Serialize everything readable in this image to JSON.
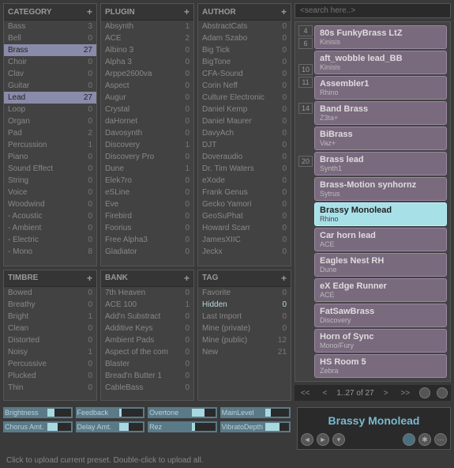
{
  "search_placeholder": "<search here..>",
  "panels": {
    "category": {
      "title": "CATEGORY",
      "items": [
        {
          "n": "Bass",
          "c": 3
        },
        {
          "n": "Bell",
          "c": 0
        },
        {
          "n": "Brass",
          "c": 27,
          "sel": true
        },
        {
          "n": "Choir",
          "c": 0
        },
        {
          "n": "Clav",
          "c": 0
        },
        {
          "n": "Guitar",
          "c": 0
        },
        {
          "n": "Lead",
          "c": 27,
          "sel": true
        },
        {
          "n": "Loop",
          "c": 0
        },
        {
          "n": "Organ",
          "c": 0
        },
        {
          "n": "Pad",
          "c": 2
        },
        {
          "n": "Percussion",
          "c": 1
        },
        {
          "n": "Piano",
          "c": 0
        },
        {
          "n": "Sound Effect",
          "c": 0
        },
        {
          "n": "String",
          "c": 0
        },
        {
          "n": "Voice",
          "c": 0
        },
        {
          "n": "Woodwind",
          "c": 0
        },
        {
          "n": "  - Acoustic",
          "c": 0
        },
        {
          "n": "  - Ambient",
          "c": 0
        },
        {
          "n": "  - Electric",
          "c": 0
        },
        {
          "n": "  - Mono",
          "c": 8
        }
      ]
    },
    "plugin": {
      "title": "PLUGIN",
      "items": [
        {
          "n": "Absynth",
          "c": 1
        },
        {
          "n": "ACE",
          "c": 2
        },
        {
          "n": "Albino 3",
          "c": 0
        },
        {
          "n": "Alpha 3",
          "c": 0
        },
        {
          "n": "Arppe2600va",
          "c": 0
        },
        {
          "n": "Aspect",
          "c": 0
        },
        {
          "n": "Augur",
          "c": 0
        },
        {
          "n": "Crystal",
          "c": 0
        },
        {
          "n": "daHornet",
          "c": 0
        },
        {
          "n": "Davosynth",
          "c": 0
        },
        {
          "n": "Discovery",
          "c": 1
        },
        {
          "n": "Discovery Pro",
          "c": 0
        },
        {
          "n": "Dune",
          "c": 1
        },
        {
          "n": "Elek7ro",
          "c": 0
        },
        {
          "n": "eSLine",
          "c": 0
        },
        {
          "n": "Eve",
          "c": 0
        },
        {
          "n": "Firebird",
          "c": 0
        },
        {
          "n": "Foorius",
          "c": 0
        },
        {
          "n": "Free Alpha3",
          "c": 0
        },
        {
          "n": "Gladiator",
          "c": 0
        }
      ]
    },
    "author": {
      "title": "AUTHOR",
      "items": [
        {
          "n": "AbstractCats",
          "c": 0
        },
        {
          "n": "Adam Szabo",
          "c": 0
        },
        {
          "n": "Big Tick",
          "c": 0
        },
        {
          "n": "BigTone",
          "c": 0
        },
        {
          "n": "CFA-Sound",
          "c": 0
        },
        {
          "n": "Corin Neff",
          "c": 0
        },
        {
          "n": "Culture Electronic",
          "c": 0
        },
        {
          "n": "Daniel Kemp",
          "c": 0
        },
        {
          "n": "Daniel Maurer",
          "c": 0
        },
        {
          "n": "DavyAch",
          "c": 0
        },
        {
          "n": "DJT",
          "c": 0
        },
        {
          "n": "Doveraudio",
          "c": 0
        },
        {
          "n": "Dr. Tim Waters",
          "c": 0
        },
        {
          "n": "eXode",
          "c": 0
        },
        {
          "n": "Frank Genus",
          "c": 0
        },
        {
          "n": "Gecko Yamori",
          "c": 0
        },
        {
          "n": "GeoSuPhat",
          "c": 0
        },
        {
          "n": "Howard Scarr",
          "c": 0
        },
        {
          "n": "JamesXIIC",
          "c": 0
        },
        {
          "n": "Jeckx",
          "c": 0
        }
      ]
    },
    "timbre": {
      "title": "TIMBRE",
      "items": [
        {
          "n": "Bowed",
          "c": 0
        },
        {
          "n": "Breathy",
          "c": 0
        },
        {
          "n": "Bright",
          "c": 1
        },
        {
          "n": "Clean",
          "c": 0
        },
        {
          "n": "Distorted",
          "c": 0
        },
        {
          "n": "Noisy",
          "c": 1
        },
        {
          "n": "Percussive",
          "c": 0
        },
        {
          "n": "Plucked",
          "c": 0
        },
        {
          "n": "Thin",
          "c": 0
        }
      ]
    },
    "bank": {
      "title": "BANK",
      "items": [
        {
          "n": "7th Heaven",
          "c": 0
        },
        {
          "n": "ACE 100",
          "c": 1
        },
        {
          "n": "Add'n Substract",
          "c": 0
        },
        {
          "n": "Additive Keys",
          "c": 0
        },
        {
          "n": "Ambient Pads",
          "c": 0
        },
        {
          "n": "Aspect of the com",
          "c": 0
        },
        {
          "n": "Blaster",
          "c": 0
        },
        {
          "n": "Bread'n Butter 1",
          "c": 0
        },
        {
          "n": "CableBass",
          "c": 0
        }
      ]
    },
    "tag": {
      "title": "TAG",
      "items": [
        {
          "n": "Favorite",
          "c": 0
        },
        {
          "n": "Hidden",
          "c": 0,
          "hi": true
        },
        {
          "n": "Last Import",
          "c": 0
        },
        {
          "n": "Mine (private)",
          "c": 0
        },
        {
          "n": "Mine (public)",
          "c": 12
        },
        {
          "n": "New",
          "c": 21
        }
      ]
    }
  },
  "numbers": [
    "4",
    "6",
    "",
    "10",
    "11",
    "",
    "14",
    "",
    "",
    "",
    "20"
  ],
  "presets": [
    {
      "name": "80s FunkyBrass LtZ",
      "sub": "Kinisis"
    },
    {
      "name": "aft_wobble lead_BB",
      "sub": "Kinisis"
    },
    {
      "name": "Assembler1",
      "sub": "Rhino"
    },
    {
      "name": "Band Brass",
      "sub": "Z3ta+"
    },
    {
      "name": "BiBrass",
      "sub": "Vaz+"
    },
    {
      "name": "Brass lead",
      "sub": "Synth1"
    },
    {
      "name": "Brass-Motion synhornz",
      "sub": "Sytrus"
    },
    {
      "name": "Brassy Monolead",
      "sub": "Rhino",
      "sel": true
    },
    {
      "name": "Car horn lead",
      "sub": "ACE"
    },
    {
      "name": "Eagles Nest RH",
      "sub": "Dune"
    },
    {
      "name": "eX Edge Runner",
      "sub": "ACE"
    },
    {
      "name": "FatSawBrass",
      "sub": "Discovery"
    },
    {
      "name": "Horn of Sync",
      "sub": "Mono/Fury"
    },
    {
      "name": "HS Room 5",
      "sub": "Zebra"
    }
  ],
  "pager": {
    "first": "<<",
    "prev": "<",
    "info": "1..27 of 27",
    "next": ">",
    "last": ">>"
  },
  "params": [
    {
      "label": "Brightness",
      "v": 30
    },
    {
      "label": "Feedback",
      "v": 10
    },
    {
      "label": "Overtone",
      "v": 55
    },
    {
      "label": "MainLevel",
      "v": 25
    },
    {
      "label": "Chorus Amt.",
      "v": 45
    },
    {
      "label": "Delay Amt.",
      "v": 40
    },
    {
      "label": "Rez",
      "v": 15
    },
    {
      "label": "VibratoDepth",
      "v": 60
    }
  ],
  "nowplaying": "Brassy Monolead",
  "status": "Click to upload current preset. Double-click to upload all."
}
